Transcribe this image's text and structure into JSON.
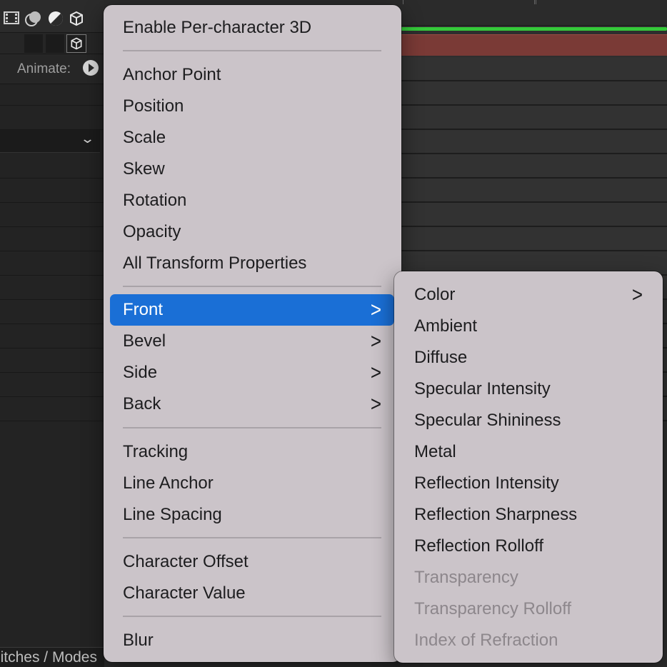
{
  "app": {
    "animate_label": "Animate:",
    "footer_label": "itches / Modes",
    "icons": [
      "film-icon",
      "motion-blur-icon",
      "adjustment-layer-icon",
      "3d-layer-icon"
    ]
  },
  "main_menu": {
    "items": [
      {
        "label": "Enable Per-character 3D",
        "submenu": false
      },
      {
        "label": "Anchor Point",
        "submenu": false
      },
      {
        "label": "Position",
        "submenu": false
      },
      {
        "label": "Scale",
        "submenu": false
      },
      {
        "label": "Skew",
        "submenu": false
      },
      {
        "label": "Rotation",
        "submenu": false
      },
      {
        "label": "Opacity",
        "submenu": false
      },
      {
        "label": "All Transform Properties",
        "submenu": false
      },
      {
        "label": "Front",
        "submenu": true,
        "highlighted": true
      },
      {
        "label": "Bevel",
        "submenu": true
      },
      {
        "label": "Side",
        "submenu": true
      },
      {
        "label": "Back",
        "submenu": true
      },
      {
        "label": "Tracking",
        "submenu": false
      },
      {
        "label": "Line Anchor",
        "submenu": false
      },
      {
        "label": "Line Spacing",
        "submenu": false
      },
      {
        "label": "Character Offset",
        "submenu": false
      },
      {
        "label": "Character Value",
        "submenu": false
      },
      {
        "label": "Blur",
        "submenu": false
      }
    ],
    "chevron": ">"
  },
  "sub_menu": {
    "items": [
      {
        "label": "Color",
        "submenu": true,
        "enabled": true
      },
      {
        "label": "Ambient",
        "enabled": true
      },
      {
        "label": "Diffuse",
        "enabled": true
      },
      {
        "label": "Specular Intensity",
        "enabled": true
      },
      {
        "label": "Specular Shininess",
        "enabled": true
      },
      {
        "label": "Metal",
        "enabled": true
      },
      {
        "label": "Reflection Intensity",
        "enabled": true
      },
      {
        "label": "Reflection Sharpness",
        "enabled": true
      },
      {
        "label": "Reflection Rolloff",
        "enabled": true
      },
      {
        "label": "Transparency",
        "enabled": false
      },
      {
        "label": "Transparency Rolloff",
        "enabled": false
      },
      {
        "label": "Index of Refraction",
        "enabled": false
      }
    ]
  },
  "colors": {
    "highlight": "#1a6fd6",
    "menu_bg": "#cbc4c9",
    "work_area": "#35c93a",
    "layer_bar": "#7a3a36"
  }
}
